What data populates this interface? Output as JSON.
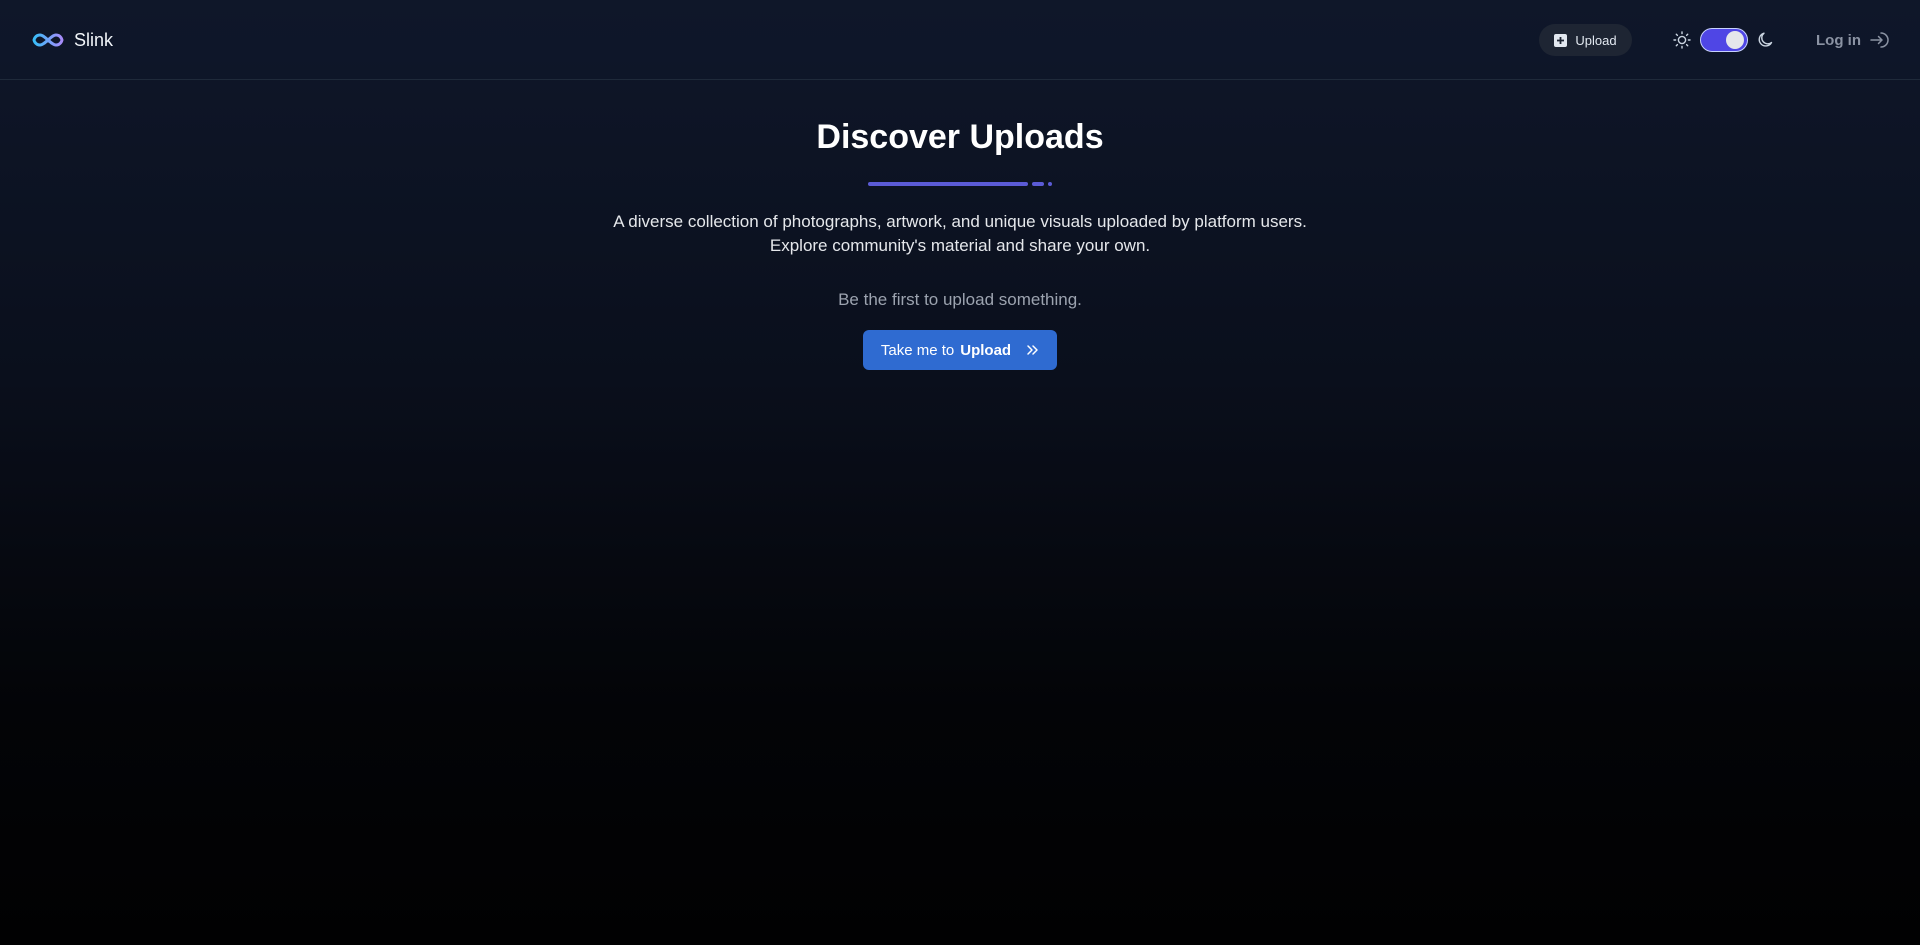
{
  "header": {
    "brand_name": "Slink",
    "upload_label": "Upload",
    "login_label": "Log in",
    "theme": "dark"
  },
  "main": {
    "title": "Discover Uploads",
    "description": "A diverse collection of photographs, artwork, and unique visuals uploaded by platform users. Explore community's material and share your own.",
    "empty_hint": "Be the first to upload something.",
    "cta_prefix": "Take me to",
    "cta_bold": "Upload"
  },
  "colors": {
    "accent": "#5b5bd6",
    "cta": "#2f6bd1",
    "toggle": "#4f46e5"
  },
  "icons": {
    "brand": "infinity-logo-icon",
    "upload": "plus-square-icon",
    "light": "sun-icon",
    "dark": "moon-icon",
    "login": "log-in-arrow-icon",
    "cta": "chevrons-right-icon"
  }
}
